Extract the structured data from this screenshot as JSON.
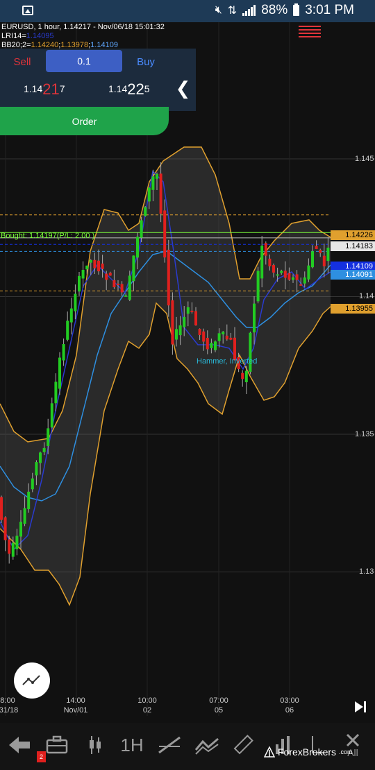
{
  "status_bar": {
    "battery": "88%",
    "time": "3:01 PM"
  },
  "chart_info": {
    "line1": "EURUSD,  1 hour, 1.14217 - Nov/06/18 15:01:32",
    "lri_label": "LRI14=",
    "lri_value": "1.14095",
    "bb_label": "BB20;2=",
    "bb_upper": "1.14240",
    "bb_lower": "1.13978",
    "bb_mid": "1.14109"
  },
  "trade_panel": {
    "sell_label": "Sell",
    "buy_label": "Buy",
    "lot": "0.1",
    "sell_price": {
      "prefix": "1.14",
      "big": "21",
      "suffix": "7"
    },
    "buy_price": {
      "prefix": "1.14",
      "big": "22",
      "suffix": "5"
    },
    "order_label": "Order"
  },
  "price_axis": [
    "1.145",
    "1.14",
    "1.135",
    "1.13"
  ],
  "price_tags": [
    {
      "value": "1.14226",
      "bg": "#e0a02e",
      "color": "#000"
    },
    {
      "value": "1.14183",
      "bg": "#e6e6e6",
      "color": "#000"
    },
    {
      "value": "1.14109",
      "bg": "#1430e0",
      "color": "#fff"
    },
    {
      "value": "1.14091",
      "bg": "#2e8fe0",
      "color": "#fff"
    },
    {
      "value": "1.13955",
      "bg": "#e0a02e",
      "color": "#000"
    }
  ],
  "time_axis": [
    {
      "time": "8:00",
      "date": "/31/18"
    },
    {
      "time": "14:00",
      "date": "Nov/01"
    },
    {
      "time": "10:00",
      "date": "02"
    },
    {
      "time": "07:00",
      "date": "05"
    },
    {
      "time": "03:00",
      "date": "06"
    }
  ],
  "bought_label": "Bought: 1.14197(P/L: 2.00 )",
  "pattern_label": "Hammer, Inverted",
  "toolbar": {
    "timeframe": "1H",
    "notification_count": "2",
    "all_label": "All"
  },
  "watermark": {
    "brand": "ForexBrokers",
    "suffix": ".com"
  },
  "chart_data": {
    "type": "candlestick",
    "symbol": "EURUSD",
    "timeframe": "1 hour",
    "last_price": 1.14217,
    "ylim": [
      1.1295,
      1.1457
    ],
    "y_ticks": [
      1.145,
      1.14,
      1.135,
      1.13
    ],
    "x_ticks": [
      "8:00 /31/18",
      "14:00 Nov/01",
      "10:00 02",
      "07:00 05",
      "03:00 06"
    ],
    "horizontal_lines": {
      "bought": 1.14197,
      "bb_upper_tag": 1.14226,
      "ask": 1.14183,
      "bb_mid": 1.14109,
      "lri": 1.14091,
      "bb_lower_tag": 1.13955
    },
    "indicators": [
      "LRI14",
      "BB20;2"
    ],
    "colors": {
      "bull": "#22cc22",
      "bear": "#e0201e",
      "bb_band": "#e0a02e",
      "bb_mid": "#2e8fe0",
      "lri": "#2a3bd0"
    }
  }
}
